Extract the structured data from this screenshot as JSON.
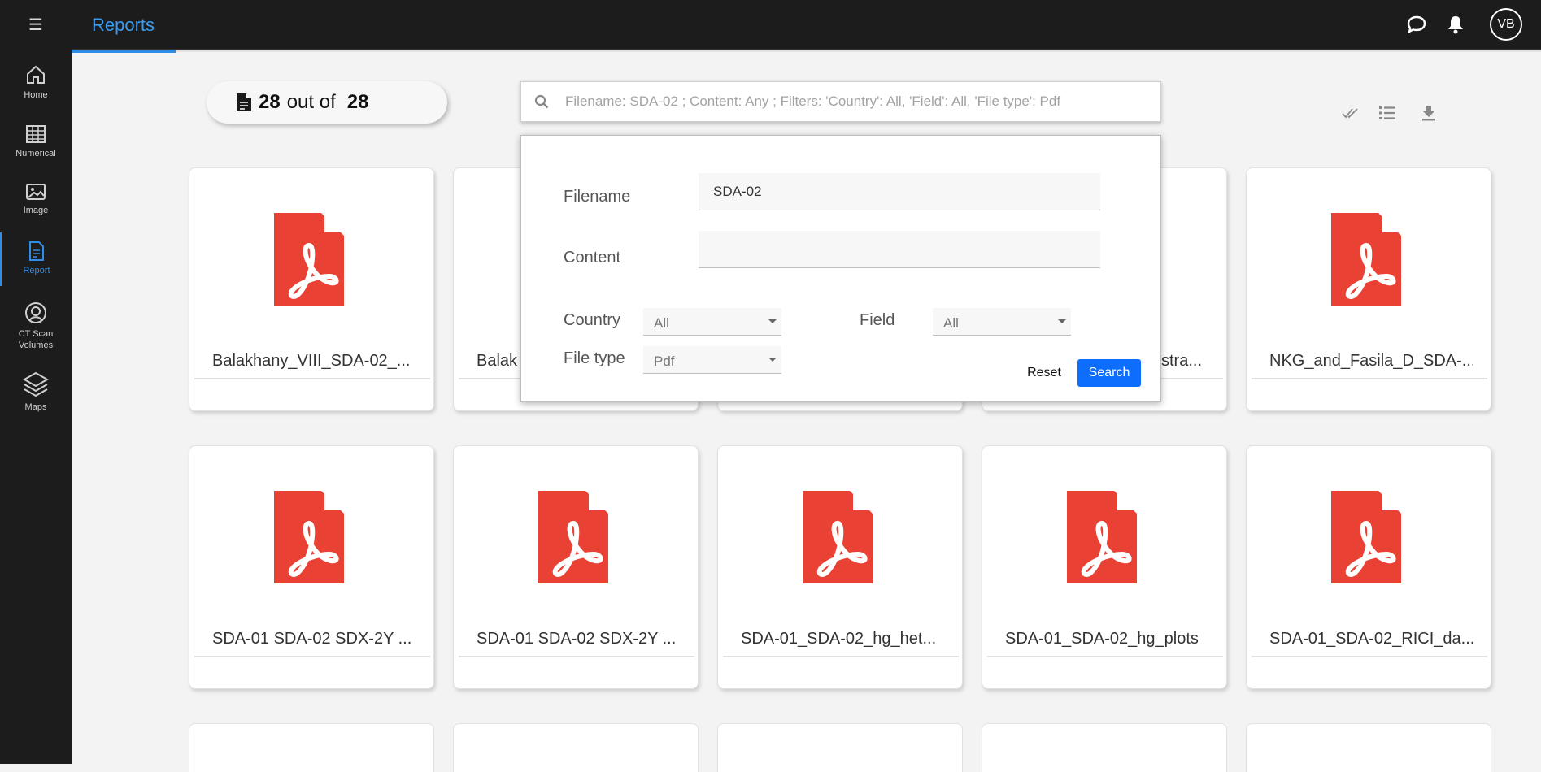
{
  "app": {
    "title": "Reports",
    "avatar_initials": "VB"
  },
  "sidebar": {
    "items": [
      {
        "label": "Home",
        "icon": "home-icon"
      },
      {
        "label": "Numerical",
        "icon": "table-icon"
      },
      {
        "label": "Image",
        "icon": "image-icon"
      },
      {
        "label": "Report",
        "icon": "document-icon",
        "active": true
      },
      {
        "label_line1": "CT Scan",
        "label_line2": "Volumes",
        "icon": "ct-scan-icon"
      },
      {
        "label": "Maps",
        "icon": "layers-icon"
      }
    ]
  },
  "results": {
    "shown": "28",
    "separator": "out of",
    "total": "28"
  },
  "search": {
    "placeholder": "Filename: SDA-02 ; Content: Any ; Filters: 'Country': All, 'Field': All, 'File type': Pdf"
  },
  "panel": {
    "filename_label": "Filename",
    "filename_value": "SDA-02",
    "content_label": "Content",
    "content_value": "",
    "country_label": "Country",
    "country_value": "All",
    "field_label": "Field",
    "field_value": "All",
    "filetype_label": "File type",
    "filetype_value": "Pdf",
    "reset_label": "Reset",
    "search_label": "Search"
  },
  "cards": [
    {
      "name": "Balakhany_VIII_SDA-02_..."
    },
    {
      "name": "Balak"
    },
    {
      "name": ""
    },
    {
      "name": "stra..."
    },
    {
      "name": "NKG_and_Fasila_D_SDA-..."
    },
    {
      "name": "SDA-01 SDA-02 SDX-2Y ..."
    },
    {
      "name": "SDA-01 SDA-02 SDX-2Y ..."
    },
    {
      "name": "SDA-01_SDA-02_hg_het..."
    },
    {
      "name": "SDA-01_SDA-02_hg_plots"
    },
    {
      "name": "SDA-01_SDA-02_RICI_da..."
    }
  ],
  "colors": {
    "accent": "#2e8de6",
    "pdf_red": "#e94235",
    "primary_button": "#0d6efd"
  }
}
